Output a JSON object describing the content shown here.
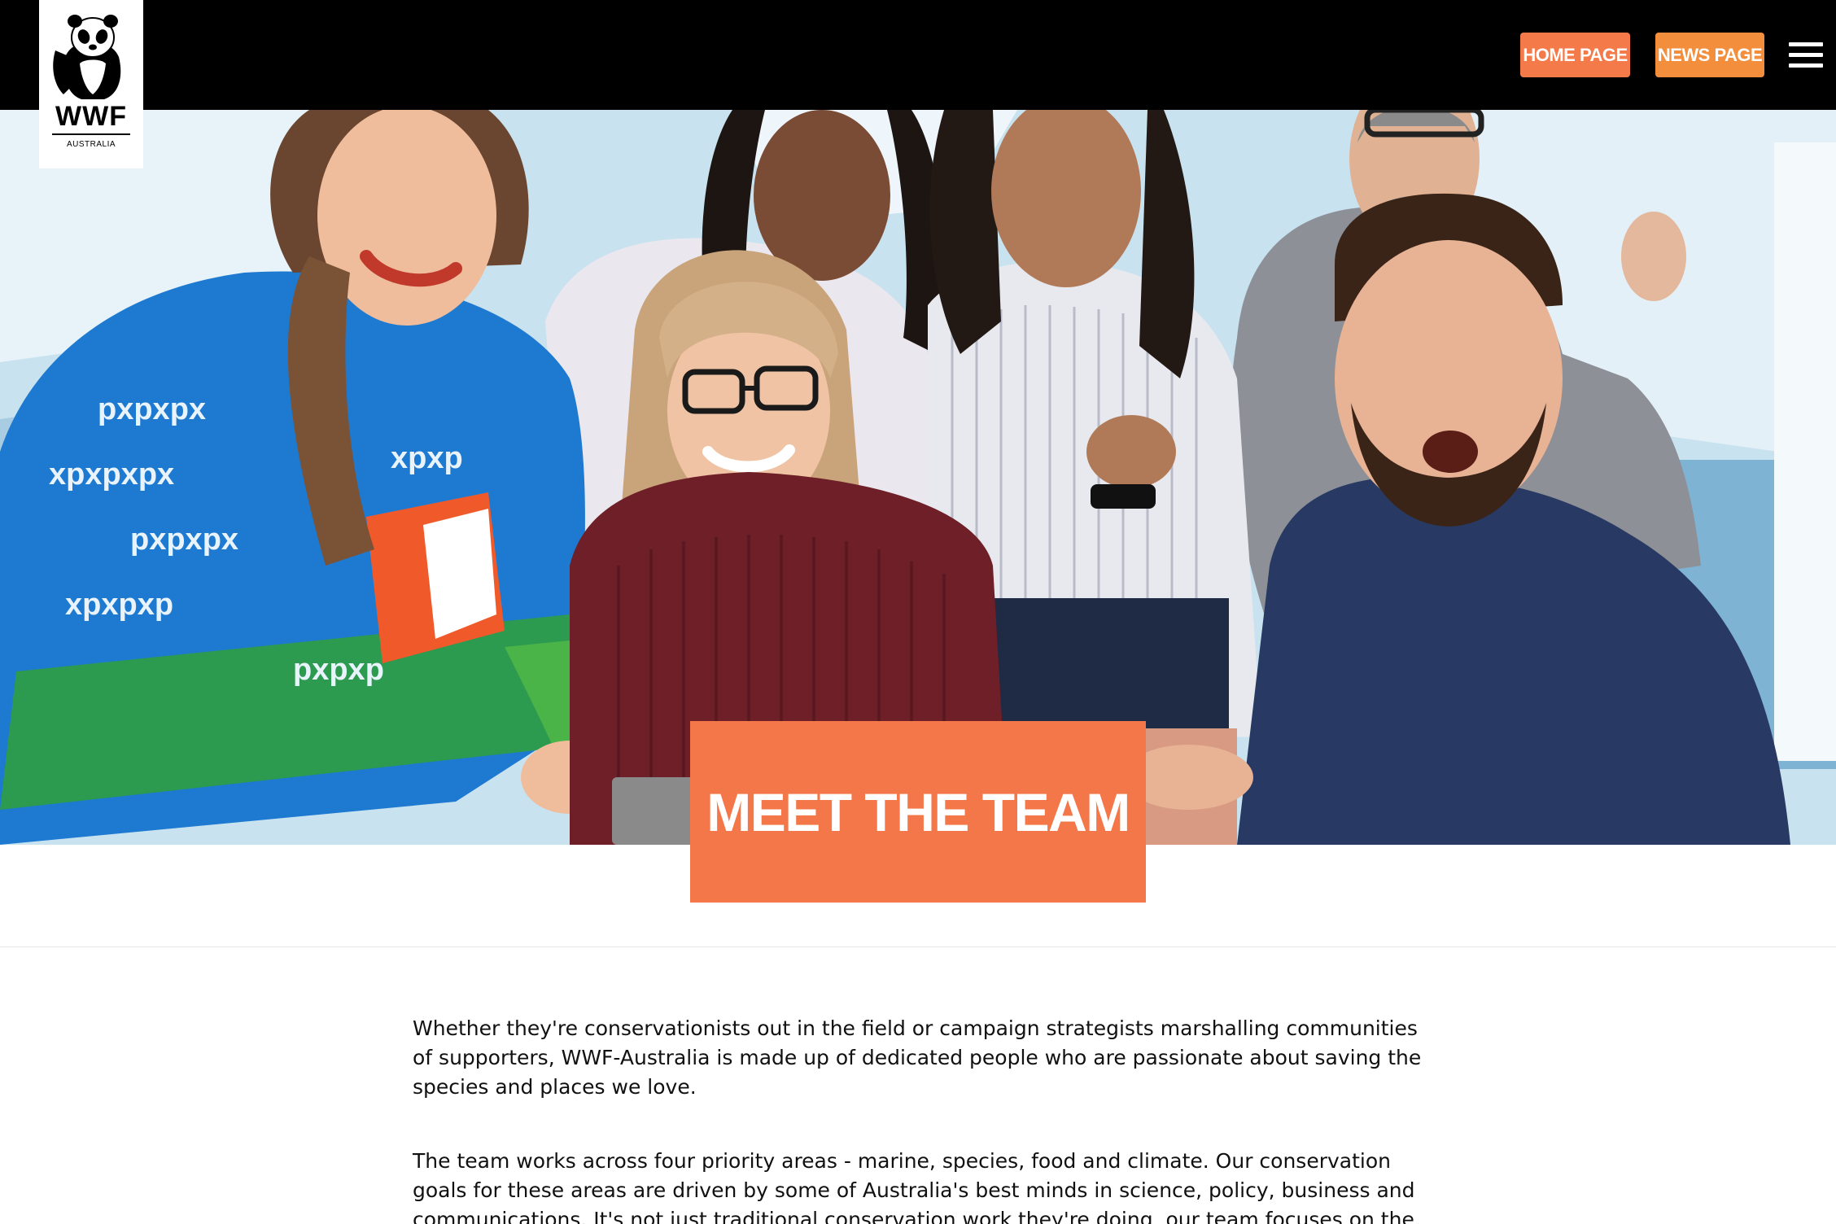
{
  "logo": {
    "brand": "WWF",
    "region": "AUSTRALIA",
    "icon": "panda-logo-icon"
  },
  "nav": {
    "home_label": "HOME PAGE",
    "news_label": "NEWS PAGE",
    "menu_icon": "hamburger-menu-icon",
    "colors": {
      "home": "#f47a49",
      "news": "#f28e3c",
      "bar": "#000000"
    }
  },
  "hero": {
    "title": "MEET THE TEAM",
    "title_bg": "#f37748"
  },
  "content": {
    "paragraphs": [
      "Whether they're conservationists out in the field or campaign strategists marshalling communities of supporters, WWF-Australia is made up of dedicated people who are passionate about saving the species and places we love.",
      "The team works across four priority areas - marine, species, food and climate. Our conservation goals for these areas are driven by some of Australia's best minds in science, policy, business and communications. It's not just traditional conservation work they're doing, our team focuses on the"
    ]
  }
}
